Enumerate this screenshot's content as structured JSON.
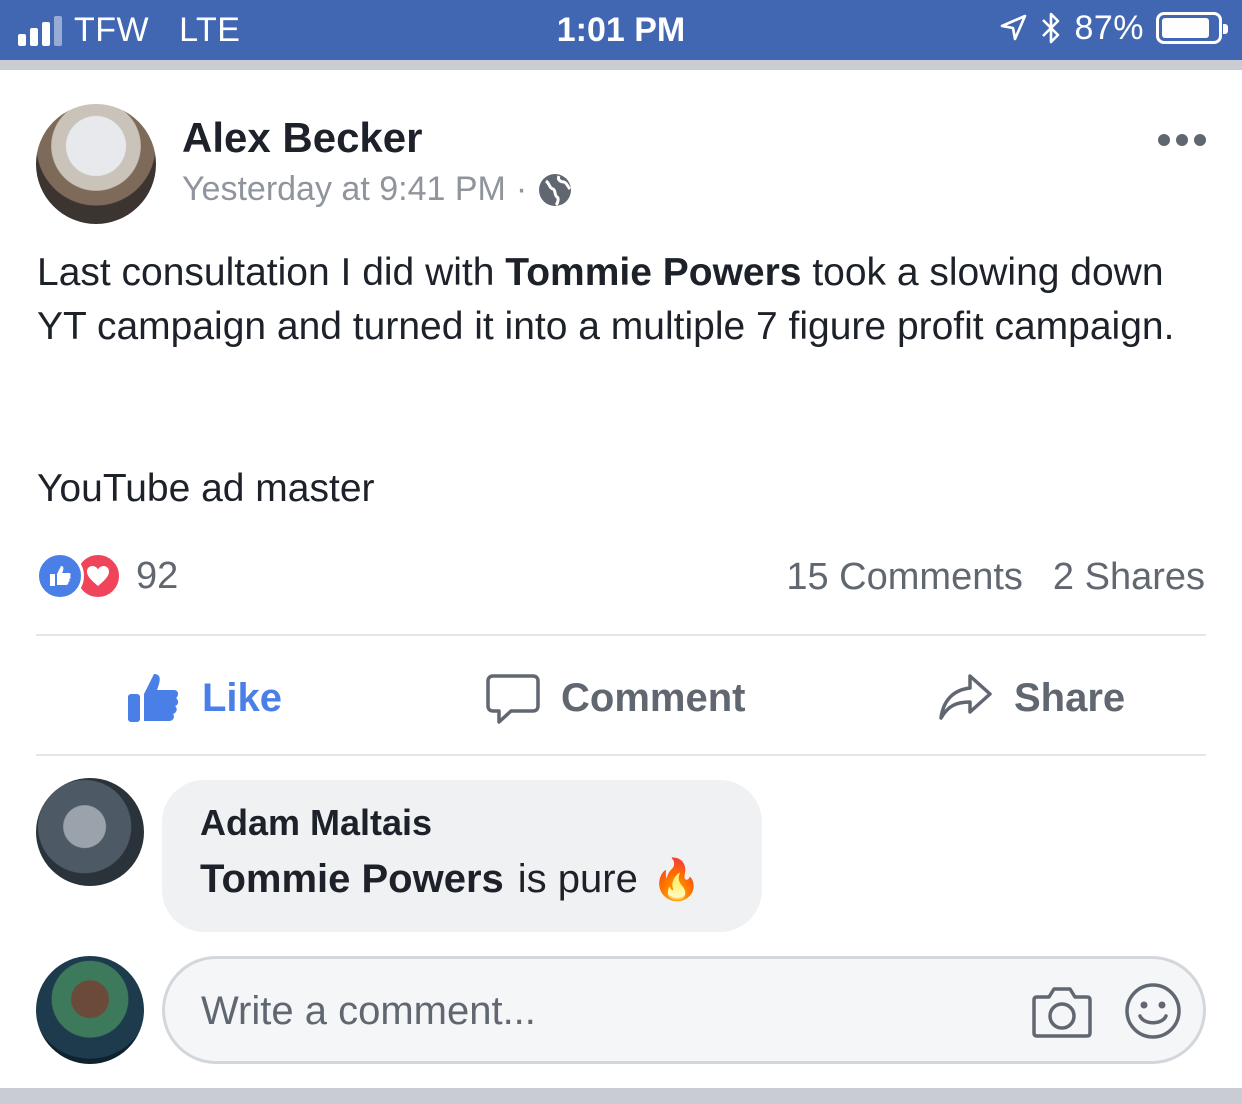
{
  "status_bar": {
    "carrier": "TFW",
    "network": "LTE",
    "time": "1:01 PM",
    "battery_text": "87%",
    "battery_level": 0.87
  },
  "post": {
    "author": "Alex Becker",
    "timestamp": "Yesterday at 9:41 PM",
    "separator": "·",
    "privacy_icon": "globe-icon",
    "text_part1": "Last consultation I did with ",
    "mention": "Tommie Powers",
    "text_part2": " took a slowing down YT campaign and turned it into a multiple 7 figure profit campaign.",
    "text_line2": "YouTube ad master",
    "reaction_count": "92",
    "comments_count": "15 Comments",
    "shares_count": "2 Shares"
  },
  "actions": {
    "like": "Like",
    "comment": "Comment",
    "share": "Share"
  },
  "comment": {
    "author": "Adam Maltais",
    "mention": "Tommie Powers",
    "text": "is pure",
    "emoji": "🔥"
  },
  "composer": {
    "placeholder": "Write a comment..."
  },
  "colors": {
    "status_bar": "#4267b2",
    "like_blue": "#4a7fe8",
    "love_red": "#f0445a",
    "text": "#1d2129",
    "secondary_text": "#606770"
  }
}
